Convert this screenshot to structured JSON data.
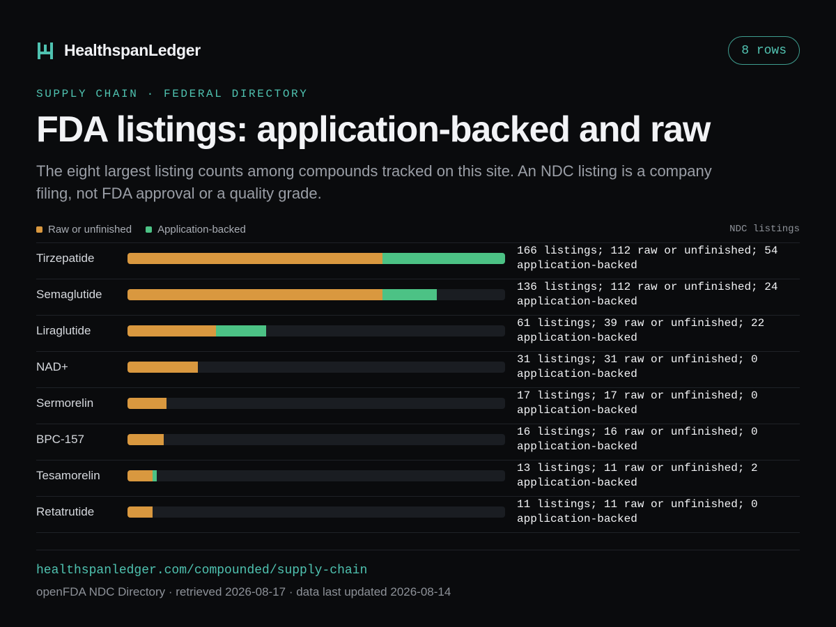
{
  "brand": {
    "name": "HealthspanLedger",
    "icon": "h-logo-icon"
  },
  "badge": "8 rows",
  "eyebrow": "SUPPLY CHAIN · FEDERAL DIRECTORY",
  "title": "FDA listings: application-backed and raw",
  "subtitle": "The eight largest listing counts among compounds tracked on this site. An NDC listing is a company filing, not FDA approval or a quality grade.",
  "axis_note": "NDC listings",
  "colors": {
    "raw": "#d9983f",
    "app": "#4cc285",
    "track": "#1a1d22",
    "accent": "#4fc2b0"
  },
  "chart_data": {
    "type": "bar",
    "orientation": "horizontal",
    "stacked": true,
    "categories": [
      "Tirzepatide",
      "Semaglutide",
      "Liraglutide",
      "NAD+",
      "Sermorelin",
      "BPC-157",
      "Tesamorelin",
      "Retatrutide"
    ],
    "series": [
      {
        "name": "Raw or unfinished",
        "values": [
          112,
          112,
          39,
          31,
          17,
          16,
          11,
          11
        ]
      },
      {
        "name": "Application-backed",
        "values": [
          54,
          24,
          22,
          0,
          0,
          0,
          2,
          0
        ]
      }
    ],
    "totals": [
      166,
      136,
      61,
      31,
      17,
      16,
      13,
      11
    ],
    "xlim": [
      0,
      166
    ],
    "value_labels": [
      "166 listings; 112 raw or unfinished; 54 application-backed",
      "136 listings; 112 raw or unfinished; 24 application-backed",
      "61 listings; 39 raw or unfinished; 22 application-backed",
      "31 listings; 31 raw or unfinished; 0 application-backed",
      "17 listings; 17 raw or unfinished; 0 application-backed",
      "16 listings; 16 raw or unfinished; 0 application-backed",
      "13 listings; 11 raw or unfinished; 2 application-backed",
      "11 listings; 11 raw or unfinished; 0 application-backed"
    ],
    "legend": [
      "Raw or unfinished",
      "Application-backed"
    ],
    "legend_position": "top-left"
  },
  "footer": {
    "url": "healthspanledger.com/compounded/supply-chain",
    "source": "openFDA NDC Directory · retrieved 2026-08-17 · data last updated 2026-08-14"
  }
}
